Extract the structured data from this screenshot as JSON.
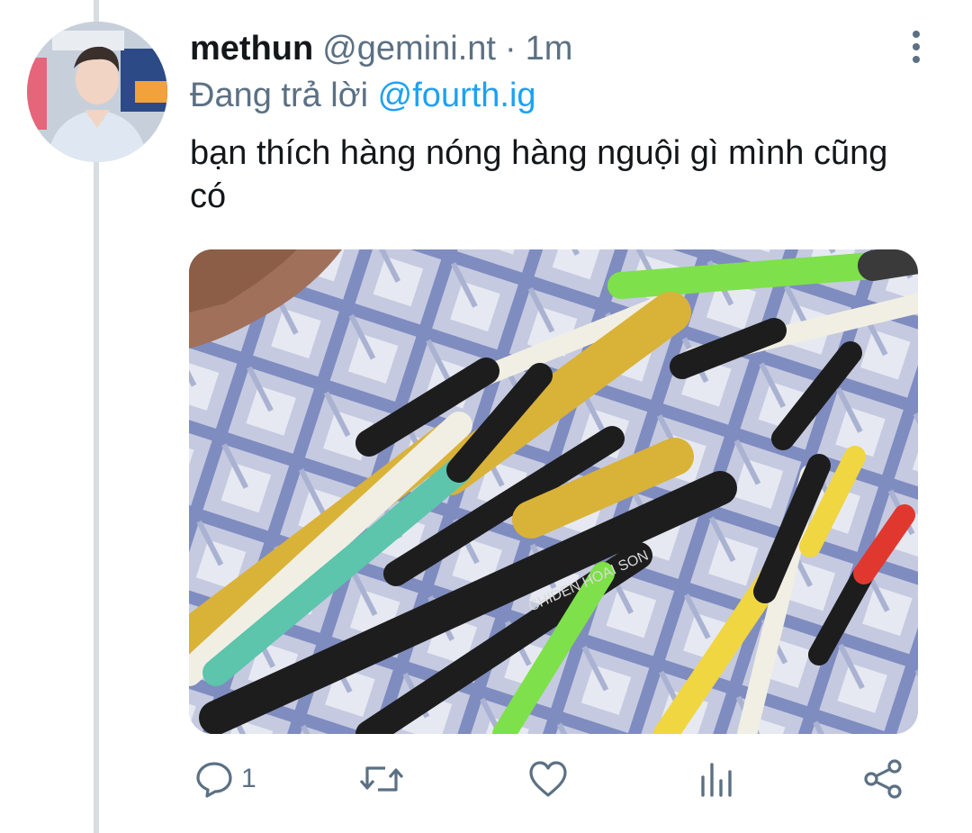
{
  "tweet": {
    "display_name": "methun",
    "handle": "@gemini.nt",
    "separator": "·",
    "time": "1m",
    "reply_prefix": "Đang trả lời",
    "reply_to": "@fourth.ig",
    "text": "bạn thích hàng nóng hàng nguội gì mình cũng có",
    "media_text": "CHIDEN HOAI SON",
    "reply_count": "1"
  },
  "icons": {
    "more": "more-vertical-icon",
    "reply": "reply-icon",
    "retweet": "retweet-icon",
    "like": "heart-icon",
    "analytics": "analytics-icon",
    "share": "share-icon"
  },
  "colors": {
    "text": "#14171a",
    "secondary": "#5b7083",
    "link": "#1da1f2",
    "thread_line": "#d8dde1"
  }
}
